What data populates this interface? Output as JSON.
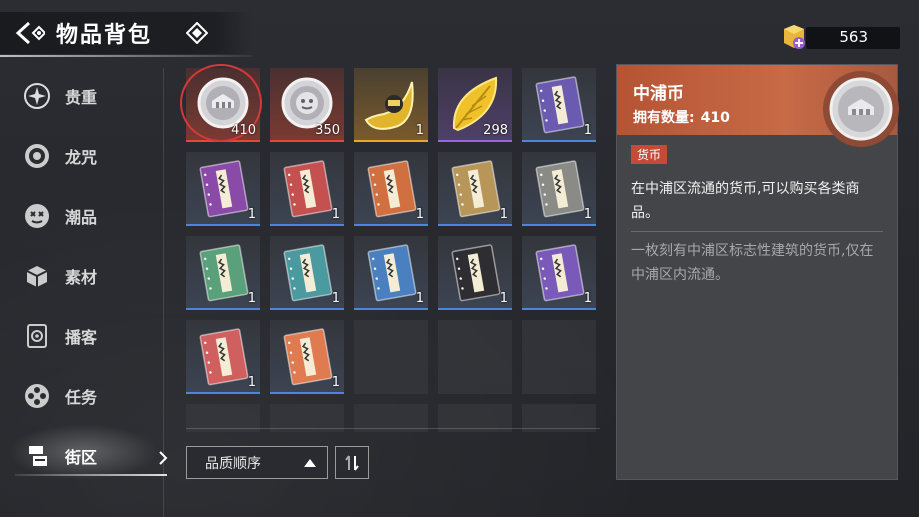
{
  "header": {
    "title": "物品背包"
  },
  "currency": {
    "value": "563",
    "icon": "gem-plus-icon",
    "color": "#e8b63a"
  },
  "sidebar": {
    "items": [
      {
        "label": "贵重",
        "icon": "star-burst-icon"
      },
      {
        "label": "龙咒",
        "icon": "target-ring-icon"
      },
      {
        "label": "潮品",
        "icon": "mask-face-icon"
      },
      {
        "label": "素材",
        "icon": "cube-box-icon"
      },
      {
        "label": "播客",
        "icon": "speaker-icon"
      },
      {
        "label": "任务",
        "icon": "film-reel-icon"
      },
      {
        "label": "街区",
        "icon": "district-icon",
        "active": true
      }
    ]
  },
  "inventory": {
    "items": [
      {
        "name": "中浦币",
        "count": "410",
        "quality": "red",
        "art": "coin-building",
        "selected": true
      },
      {
        "name": "coin-2",
        "count": "350",
        "quality": "red",
        "art": "coin-face"
      },
      {
        "name": "horn",
        "count": "1",
        "quality": "gold",
        "art": "horn"
      },
      {
        "name": "leaf",
        "count": "298",
        "quality": "purple",
        "art": "leaf"
      },
      {
        "name": "book",
        "count": "1",
        "quality": "blue",
        "art": "book",
        "color": "#6a5bb0"
      },
      {
        "name": "book",
        "count": "1",
        "quality": "blue",
        "art": "book",
        "color": "#8a4aa8"
      },
      {
        "name": "book",
        "count": "1",
        "quality": "blue",
        "art": "book",
        "color": "#c45050"
      },
      {
        "name": "book",
        "count": "1",
        "quality": "blue",
        "art": "book",
        "color": "#d07040"
      },
      {
        "name": "book",
        "count": "1",
        "quality": "blue",
        "art": "book",
        "color": "#b8965a"
      },
      {
        "name": "book",
        "count": "1",
        "quality": "blue",
        "art": "book",
        "color": "#8a8a86"
      },
      {
        "name": "book",
        "count": "1",
        "quality": "blue",
        "art": "book",
        "color": "#5aa07a"
      },
      {
        "name": "book",
        "count": "1",
        "quality": "blue",
        "art": "book",
        "color": "#4a9aa0"
      },
      {
        "name": "book",
        "count": "1",
        "quality": "blue",
        "art": "book",
        "color": "#4a80c0"
      },
      {
        "name": "book",
        "count": "1",
        "quality": "blue",
        "art": "book",
        "color": "#2e2e32"
      },
      {
        "name": "book",
        "count": "1",
        "quality": "blue",
        "art": "book",
        "color": "#7a5ab8"
      },
      {
        "name": "book",
        "count": "1",
        "quality": "blue",
        "art": "book",
        "color": "#d06060"
      },
      {
        "name": "book",
        "count": "1",
        "quality": "blue",
        "art": "book",
        "color": "#e07a50"
      }
    ],
    "empty_full": 3,
    "empty_short": 5
  },
  "sort": {
    "label": "品质顺序"
  },
  "detail": {
    "name": "中浦币",
    "owned_label": "拥有数量:",
    "owned_value": "410",
    "tag": "货币",
    "description": "在中浦区流通的货币,可以购买各类商品。",
    "lore": "一枚刻有中浦区标志性建筑的货币,仅在中浦区内流通。"
  }
}
